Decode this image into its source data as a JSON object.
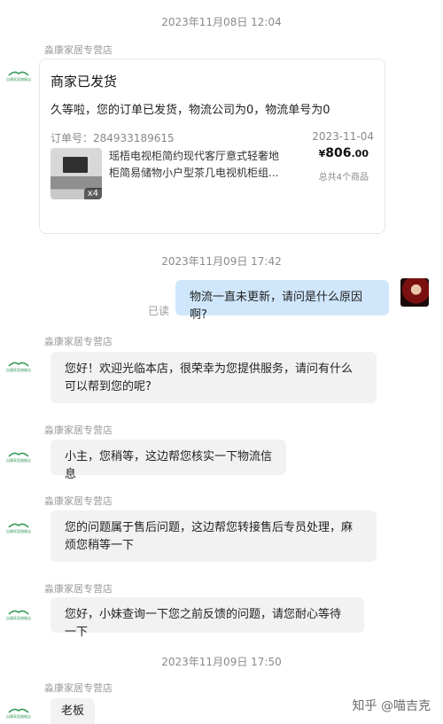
{
  "shop": {
    "name": "淼康家居专营店",
    "avatar_mini": "自康家居旗舰店"
  },
  "timestamps": [
    "2023年11月08日 12:04",
    "2023年11月09日 17:42",
    "2023年11月09日 17:50"
  ],
  "order_card": {
    "title": "商家已发货",
    "message": "久等啦，您的订单已发货，物流公司为0，物流单号为0",
    "order_no": "订单号：284933189615",
    "date": "2023-11-04",
    "product_name": "瑶梧电视柜简约现代客厅意式轻奢地柜简易储物小户型茶几电视机柜组...",
    "price_symbol": "¥",
    "price_main": "806",
    "price_decimal": ".00",
    "item_count": "总共4个商品",
    "quantity": "x4"
  },
  "user_message": {
    "text": "物流一直未更新，请问是什么原因啊?",
    "status": "已读"
  },
  "shop_messages": [
    "您好！欢迎光临本店，很荣幸为您提供服务，请问有什么可以帮到您的呢?",
    "小主，您稍等，这边帮您核实一下物流信息",
    "您的问题属于售后问题，这边帮您转接售后专员处理，麻烦您稍等一下",
    "您好，小妹查询一下您之前反馈的问题，请您耐心等待一下",
    "老板"
  ],
  "watermark": "知乎 @喵吉克",
  "colors": {
    "user_bubble": "#cfe6fb",
    "shop_bubble": "#f2f2f2",
    "logo_green": "#3a9a5a"
  }
}
